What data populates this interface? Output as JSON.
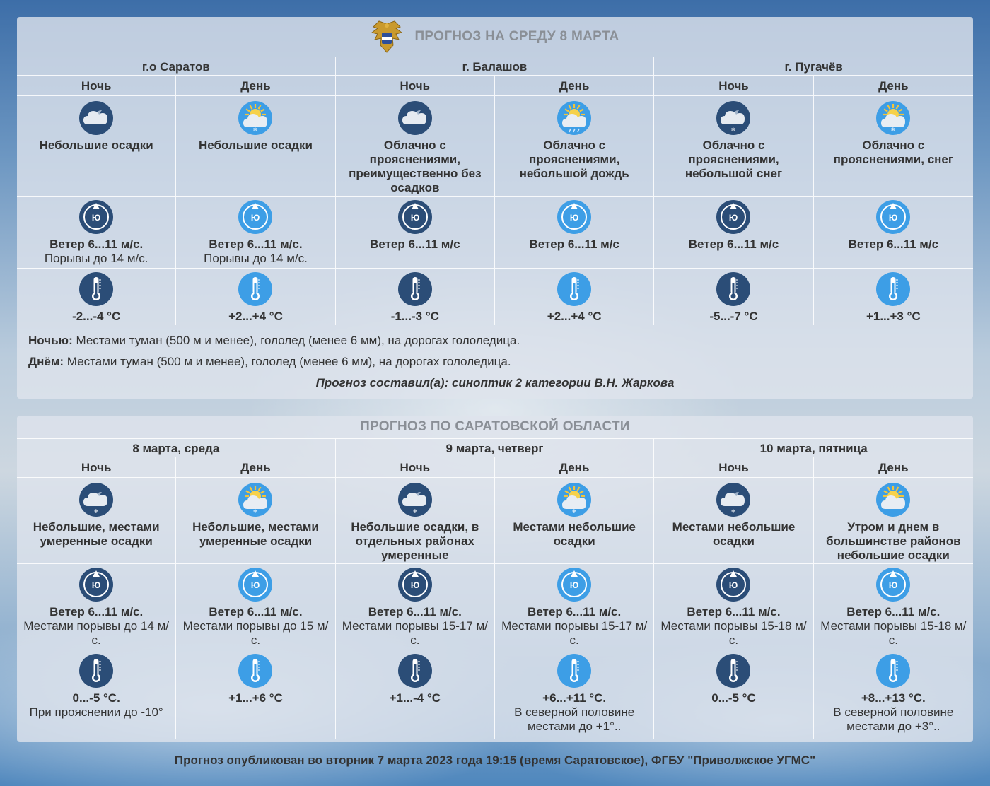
{
  "city_forecast": {
    "title": "ПРОГНОЗ НА СРЕДУ 8 МАРТА",
    "locations": [
      "г.о Саратов",
      "г. Балашов",
      "г. Пугачёв"
    ],
    "periods": [
      {
        "tod": "Ночь",
        "icon": "cloud-night-icon",
        "condition": "Небольшие осадки",
        "wind": "Ветер 6...11 м/с.",
        "gusts": "Порывы до 14 м/с.",
        "temp": "-2...-4 °С"
      },
      {
        "tod": "День",
        "icon": "sun-cloud-snow-icon",
        "condition": "Небольшие осадки",
        "wind": "Ветер 6...11 м/с.",
        "gusts": "Порывы до 14 м/с.",
        "temp": "+2...+4 °С"
      },
      {
        "tod": "Ночь",
        "icon": "cloud-night-icon",
        "condition": "Облачно с прояснениями, преимущественно без осадков",
        "wind": "Ветер 6...11 м/с",
        "gusts": "",
        "temp": "-1...-3 °С"
      },
      {
        "tod": "День",
        "icon": "sun-cloud-rain-icon",
        "condition": "Облачно с прояснениями, небольшой дождь",
        "wind": "Ветер 6...11 м/с",
        "gusts": "",
        "temp": "+2...+4 °С"
      },
      {
        "tod": "Ночь",
        "icon": "cloud-night-snow-icon",
        "condition": "Облачно с прояснениями, небольшой снег",
        "wind": "Ветер 6...11 м/с",
        "gusts": "",
        "temp": "-5...-7 °С"
      },
      {
        "tod": "День",
        "icon": "sun-cloud-snow-icon",
        "condition": "Облачно с прояснениями, снег",
        "wind": "Ветер 6...11 м/с",
        "gusts": "",
        "temp": "+1...+3 °С"
      }
    ],
    "notes": {
      "night_label": "Ночью:",
      "night_text": " Местами туман (500 м и менее), гололед (менее 6 мм), на дорогах гололедица.",
      "day_label": "Днём:",
      "day_text": " Местами туман (500 м и менее), гололед (менее 6 мм), на дорогах гололедица."
    },
    "author": "Прогноз составил(а): синоптик 2 категории В.Н. Жаркова"
  },
  "region_forecast": {
    "title": "ПРОГНОЗ ПО САРАТОВСКОЙ ОБЛАСТИ",
    "days": [
      "8 марта, среда",
      "9 марта, четверг",
      "10 марта, пятница"
    ],
    "periods": [
      {
        "tod": "Ночь",
        "icon": "cloud-night-snow-icon",
        "condition": "Небольшие, местами умеренные осадки",
        "wind": "Ветер 6...11 м/с.",
        "gusts": "Местами порывы до 14 м/с.",
        "temp": "0...-5 °С.",
        "extra": "При прояснении до -10°"
      },
      {
        "tod": "День",
        "icon": "sun-cloud-snow-icon",
        "condition": "Небольшие, местами умеренные осадки",
        "wind": "Ветер 6...11 м/с.",
        "gusts": "Местами порывы до 15 м/с.",
        "temp": "+1...+6 °С",
        "extra": ""
      },
      {
        "tod": "Ночь",
        "icon": "cloud-night-snow-icon",
        "condition": "Небольшие осадки, в отдельных районах умеренные",
        "wind": "Ветер 6...11 м/с.",
        "gusts": "Местами порывы 15-17 м/с.",
        "temp": "+1...-4 °С",
        "extra": ""
      },
      {
        "tod": "День",
        "icon": "sun-cloud-snow-icon",
        "condition": "Местами небольшие осадки",
        "wind": "Ветер 6...11 м/с.",
        "gusts": "Местами порывы 15-17 м/с.",
        "temp": "+6...+11 °С.",
        "extra": "В северной половине местами до +1°.."
      },
      {
        "tod": "Ночь",
        "icon": "cloud-night-snow-icon",
        "condition": "Местами небольшие осадки",
        "wind": "Ветер 6...11 м/с.",
        "gusts": "Местами порывы 15-18 м/с.",
        "temp": "0...-5 °С",
        "extra": ""
      },
      {
        "tod": "День",
        "icon": "sun-cloud-icon",
        "condition": "Утром и днем в большинстве районов небольшие осадки",
        "wind": "Ветер 6...11 м/с.",
        "gusts": "Местами порывы 15-18 м/с.",
        "temp": "+8...+13 °С.",
        "extra": "В северной половине местами до +3°.."
      }
    ]
  },
  "wind_compass_letter": "Ю",
  "footer": "Прогноз опубликован во вторник 7 марта 2023 года 19:15 (время Саратовское), ФГБУ \"Приволжское УГМС\"",
  "colors": {
    "night_circle": "#2b4d77",
    "day_circle": "#3d9ee6",
    "title_gray": "#8a8f96"
  }
}
